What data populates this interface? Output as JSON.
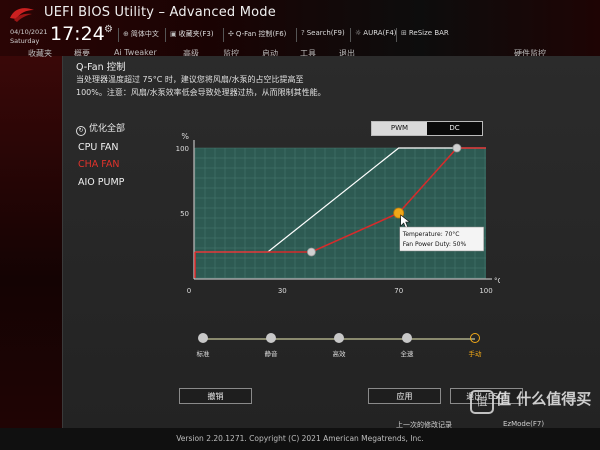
{
  "header": {
    "title": "UEFI BIOS Utility – Advanced Mode",
    "date": "04/10/2021",
    "day": "Saturday",
    "time": "17:24",
    "tools": [
      {
        "icon": "globe-icon",
        "label": "简体中文"
      },
      {
        "icon": "bookmark-icon",
        "label": "收藏夹(F3)"
      },
      {
        "icon": "fan-icon",
        "label": "Q-Fan 控制(F6)"
      },
      {
        "icon": "help-icon",
        "label": "Search(F9)"
      },
      {
        "icon": "aura-icon",
        "label": "AURA(F4)"
      },
      {
        "icon": "resize-icon",
        "label": "ReSize BAR"
      }
    ],
    "tabs": [
      "收藏夹",
      "概要",
      "Ai Tweaker",
      "高级",
      "监控",
      "启动",
      "工具",
      "退出",
      "硬件监控"
    ]
  },
  "dialog": {
    "title": "Q-Fan 控制",
    "description_line1": "当处理器温度超过 75°C 时，建议您将风扇/水泵的占空比提高至",
    "description_line2": "100%。注意：风扇/水泵效率低会导致处理器过热，从而限制其性能。",
    "optimize_all": "优化全部",
    "fans": [
      "CPU FAN",
      "CHA FAN",
      "AIO PUMP"
    ],
    "active_fan_index": 1,
    "mode_pwm": "PWM",
    "mode_dc": "DC",
    "mode_selected": "PWM",
    "presets": [
      "标准",
      "静音",
      "高效",
      "全速",
      "手动"
    ],
    "active_preset_index": 4,
    "undo_label": "撤销",
    "apply_label": "应用",
    "exit_label": "退出 (ESC)",
    "history_label": "上一次的修改记录",
    "ez_mode_label": "EzMode(F7)"
  },
  "chart_data": {
    "type": "line",
    "x_unit": "°C",
    "y_unit": "%",
    "xlim": [
      0,
      100
    ],
    "ylim": [
      0,
      100
    ],
    "x_ticks": [
      0,
      30,
      70,
      100
    ],
    "y_ticks": [
      50,
      100
    ],
    "series": [
      {
        "color": "#ffffff",
        "points": [
          [
            0,
            20
          ],
          [
            25,
            20
          ],
          [
            70,
            100
          ],
          [
            100,
            100
          ]
        ]
      },
      {
        "color": "#d62b2b",
        "points": [
          [
            0,
            20
          ],
          [
            40,
            20
          ],
          [
            70,
            50
          ],
          [
            90,
            100
          ],
          [
            100,
            100
          ]
        ]
      }
    ],
    "handles": [
      [
        40,
        20
      ],
      [
        70,
        50
      ],
      [
        90,
        100
      ]
    ],
    "selected_handle": [
      70,
      50
    ],
    "tooltip_temperature": "Temperature: 70°C",
    "tooltip_duty": "Fan Power Duty: 50%"
  },
  "colors": {
    "accent_red": "#d62b2b",
    "preset_active": "#f0a818",
    "plot_bg": "#2d5a52"
  },
  "footer": {
    "version": "Version 2.20.1271. Copyright (C) 2021 American Megatrends, Inc."
  },
  "watermark": {
    "text": "值 什么值得买"
  }
}
